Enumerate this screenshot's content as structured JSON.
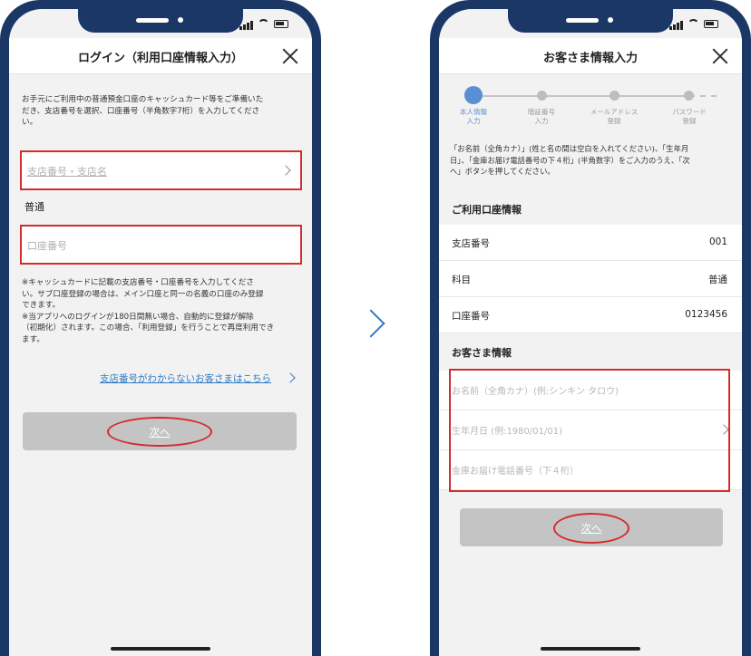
{
  "left_screen": {
    "title": "ログイン（利用口座情報入力）",
    "intro_line1": "お手元にご利用中の普通預金口座のキャッシュカード等をご準備いた",
    "intro_line2": "だき、支店番号を選択、口座番号（半角数字7桁）を入力してくださ",
    "intro_line3": "い。",
    "branch_placeholder": "支店番号・支店名",
    "account_type": "普通",
    "account_placeholder": "口座番号",
    "note_line1": "※キャッシュカードに記載の支店番号・口座番号を入力してくださ",
    "note_line2": "い。サブ口座登録の場合は、メイン口座と同一の名義の口座のみ登録",
    "note_line3": "できます。",
    "note_line4": "※当アプリへのログインが180日間無い場合、自動的に登録が解除",
    "note_line5": "（初期化）されます。この場合、「利用登録」を行うことで再度利用でき",
    "note_line6": "ます。",
    "branch_help_link": "支店番号がわからないお客さまはこちら",
    "next_label": "次へ"
  },
  "right_screen": {
    "title": "お客さま情報入力",
    "steps": [
      {
        "line1": "本人情報",
        "line2": "入力"
      },
      {
        "line1": "暗証番号",
        "line2": "入力"
      },
      {
        "line1": "メールアドレス",
        "line2": "登録"
      },
      {
        "line1": "パスワード",
        "line2": "登録"
      }
    ],
    "instr_line1": "「お名前（全角カナ）」(姓と名の間は空白を入れてください)、「生年月",
    "instr_line2": "日」、「金庫お届け電話番号の下４桁」(半角数字）をご入力のうえ、「次",
    "instr_line3": "へ」ボタンを押してください。",
    "account_section": "ご利用口座情報",
    "branch_label": "支店番号",
    "branch_value": "001",
    "type_label": "科目",
    "type_value": "普通",
    "number_label": "口座番号",
    "number_value": "0123456",
    "customer_section": "お客さま情報",
    "name_placeholder": "お名前（全角カナ）(例:シンキン タロウ)",
    "dob_placeholder": "生年月日 (例:1980/01/01)",
    "phone_placeholder": "金庫お届け電話番号（下４桁）",
    "next_label": "次へ"
  },
  "colors": {
    "frame": "#1b3766",
    "highlight": "#d42c2c",
    "link": "#2e7bc6",
    "step_active": "#5b8fd3",
    "button_disabled": "#c4c4c4"
  }
}
